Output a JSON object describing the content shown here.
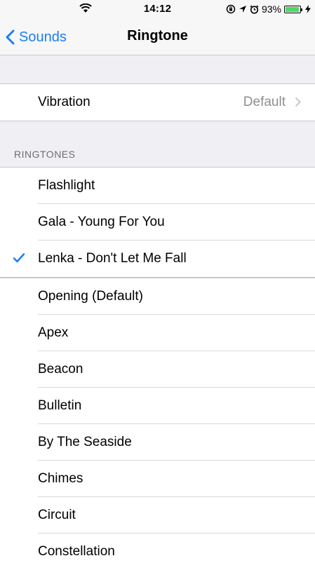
{
  "status_bar": {
    "time": "14:12",
    "battery_percent": "93%",
    "battery_level": 0.93,
    "icons": [
      "wifi-icon",
      "rotation-lock-icon",
      "location-icon",
      "alarm-icon",
      "battery-icon",
      "charging-icon"
    ]
  },
  "nav": {
    "back_label": "Sounds",
    "title": "Ringtone"
  },
  "vibration": {
    "label": "Vibration",
    "value": "Default"
  },
  "ringtones_header": "RINGTONES",
  "custom_tones": [
    {
      "label": "Flashlight",
      "selected": false
    },
    {
      "label": "Gala - Young For You",
      "selected": false
    },
    {
      "label": "Lenka - Don't Let Me Fall",
      "selected": true
    }
  ],
  "system_tones": [
    {
      "label": "Opening (Default)"
    },
    {
      "label": "Apex"
    },
    {
      "label": "Beacon"
    },
    {
      "label": "Bulletin"
    },
    {
      "label": "By The Seaside"
    },
    {
      "label": "Chimes"
    },
    {
      "label": "Circuit"
    },
    {
      "label": "Constellation"
    }
  ],
  "colors": {
    "accent": "#1a7df5",
    "background": "#efeff4",
    "secondary_text": "#8e8e93",
    "battery": "#4cd964"
  }
}
